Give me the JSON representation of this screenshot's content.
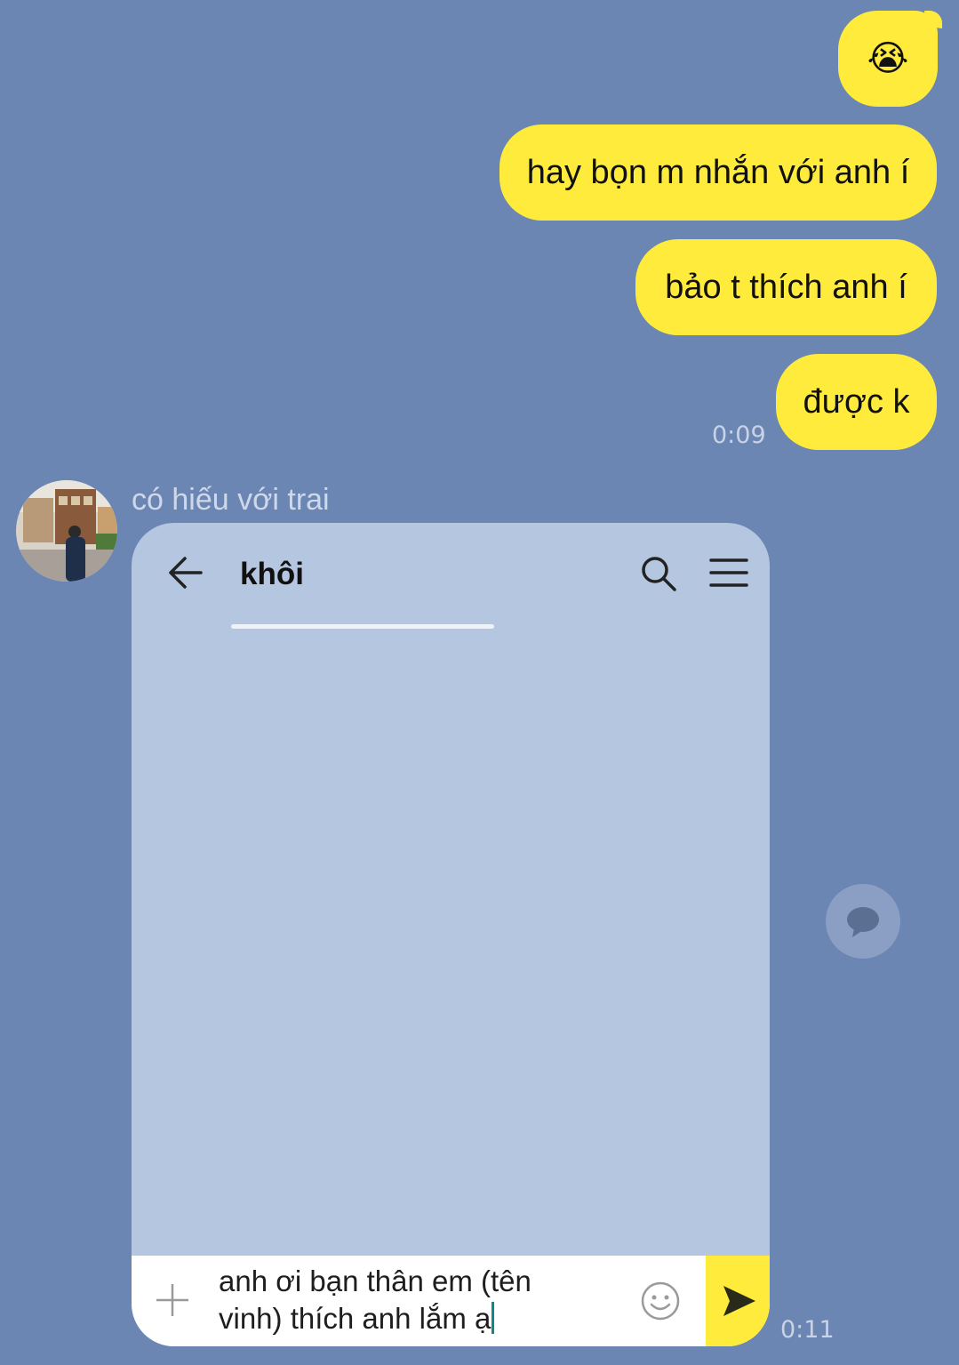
{
  "messages_out": [
    {
      "text": "😭"
    },
    {
      "text": "hay bọn m nhắn với anh í"
    },
    {
      "text": "bảo t thích anh í"
    },
    {
      "text": "được k"
    }
  ],
  "time_out": "0:09",
  "incoming": {
    "sender": "có hiếu với trai",
    "time": "0:11",
    "screenshot": {
      "header_title": "khôi",
      "input_line1": "anh ơi bạn thân em (tên",
      "input_line2": "vinh) thích anh lắm ạ"
    }
  },
  "icons": {
    "back": "arrow-left-icon",
    "search": "search-icon",
    "menu": "hamburger-menu-icon",
    "plus": "plus-icon",
    "emoji": "smiley-icon",
    "send": "send-arrow-icon",
    "float": "chat-bubble-icon"
  },
  "colors": {
    "background": "#6b86b3",
    "bubble": "#ffeb3b",
    "screenshot_bg": "#b4c6e0"
  }
}
